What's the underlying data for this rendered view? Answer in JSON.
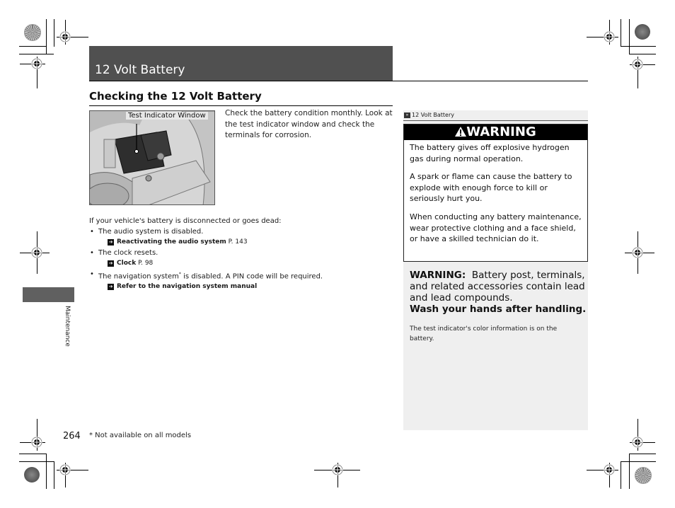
{
  "header": {
    "title": "12 Volt Battery"
  },
  "section": {
    "heading": "Checking the 12 Volt Battery",
    "image_label": "Test Indicator Window",
    "intro": "Check the battery condition monthly. Look at the test indicator window and check the terminals for corrosion.",
    "lead": "If your vehicle's battery is disconnected or goes dead:",
    "bullets": [
      {
        "text": "The audio system is disabled.",
        "ref_bold": "Reactivating the audio system",
        "ref_page": "P. 143"
      },
      {
        "text": "The clock resets.",
        "ref_bold": "Clock",
        "ref_page": "P. 98"
      },
      {
        "text_before": "The navigation system",
        "asterisk": "*",
        "text_after": " is disabled. A PIN code will be required.",
        "ref_bold": "Refer to the navigation system manual",
        "ref_page": ""
      }
    ]
  },
  "sidebar": {
    "ref_title": "12 Volt Battery",
    "warning": {
      "heading": "WARNING",
      "paragraphs": [
        "The battery gives off explosive hydrogen gas during normal operation.",
        "A spark or flame can cause the battery to explode with enough force to kill or seriously hurt you.",
        "When conducting any battery maintenance, wear protective clothing and a face shield, or have a skilled technician do it."
      ]
    },
    "lead_warning": {
      "label": "WARNING:",
      "text": "Battery post, terminals, and related accessories contain lead and lead compounds.",
      "wash": "Wash your hands after handling."
    },
    "note": "The test indicator's color information is on the battery."
  },
  "chapter_tab": "Maintenance",
  "footer": {
    "page_number": "264",
    "footnote": "* Not available on all models"
  }
}
